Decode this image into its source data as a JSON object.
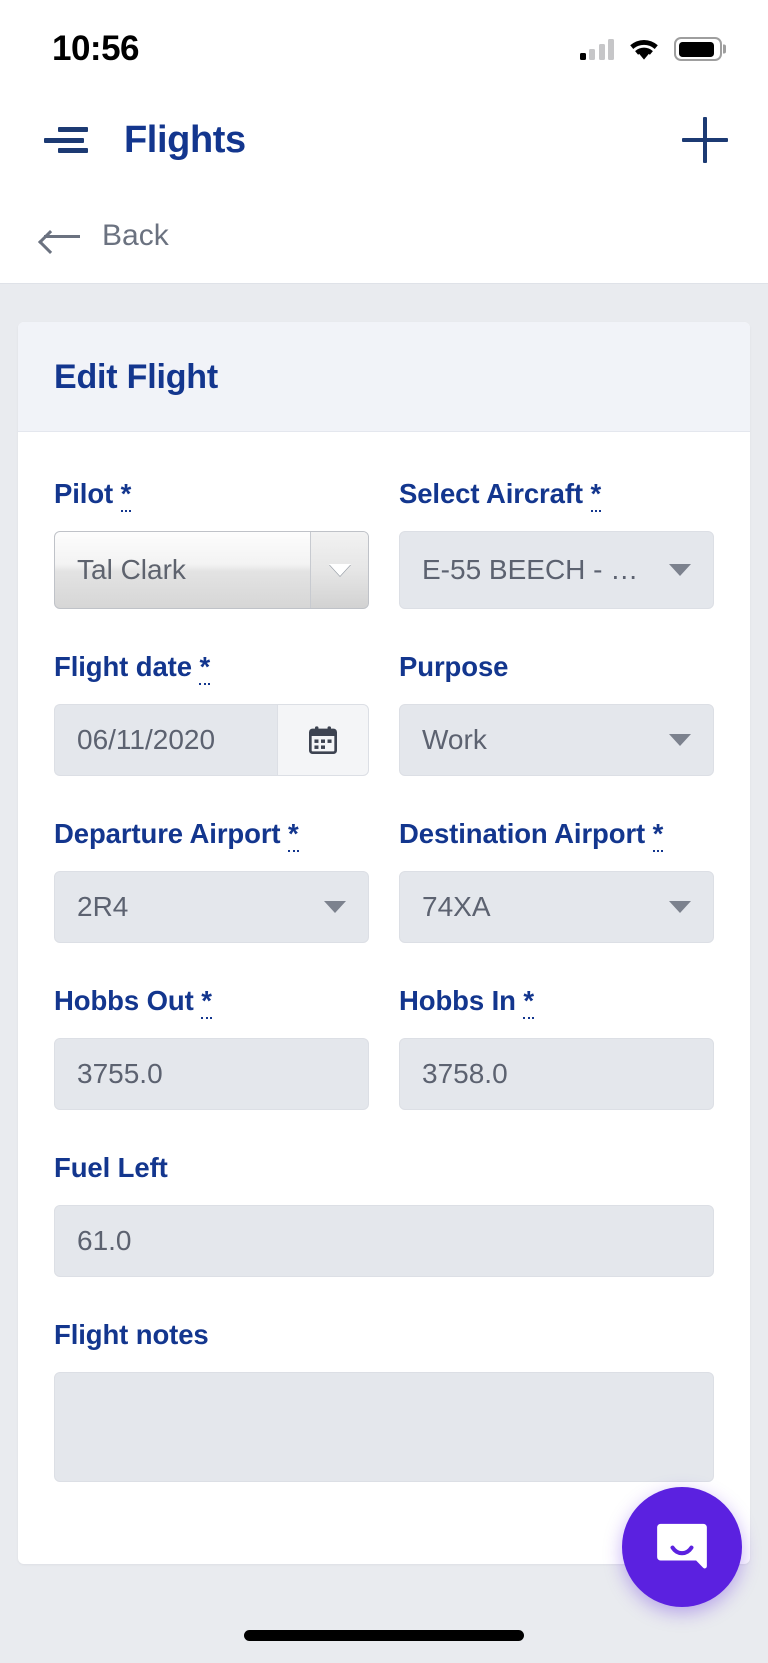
{
  "status_bar": {
    "time": "10:56",
    "cellular_icon": "cellular-signal-icon",
    "wifi_icon": "wifi-icon",
    "battery_icon": "battery-full-icon"
  },
  "app_bar": {
    "menu_icon": "hamburger-menu-icon",
    "title": "Flights",
    "add_icon": "plus-icon",
    "title_color": "#13368e"
  },
  "back_bar": {
    "arrow_icon": "arrow-left-icon",
    "label": "Back"
  },
  "card": {
    "title": "Edit Flight"
  },
  "form": {
    "pilot": {
      "label": "Pilot",
      "required_mark": "*",
      "value": "Tal Clark",
      "control": "select"
    },
    "aircraft": {
      "label": "Select Aircraft",
      "required_mark": "*",
      "value": "E-55 BEECH - N3...",
      "control": "select"
    },
    "flight_date": {
      "label": "Flight date",
      "required_mark": "*",
      "value": "06/11/2020",
      "calendar_icon": "calendar-icon",
      "control": "date"
    },
    "purpose": {
      "label": "Purpose",
      "required_mark": "",
      "value": "Work",
      "control": "select"
    },
    "departure_airport": {
      "label": "Departure Airport",
      "required_mark": "*",
      "value": "2R4",
      "control": "select"
    },
    "destination_airport": {
      "label": "Destination Airport",
      "required_mark": "*",
      "value": "74XA",
      "control": "select"
    },
    "hobbs_out": {
      "label": "Hobbs Out",
      "required_mark": "*",
      "value": "3755.0",
      "control": "text"
    },
    "hobbs_in": {
      "label": "Hobbs In",
      "required_mark": "*",
      "value": "3758.0",
      "control": "text"
    },
    "fuel_left": {
      "label": "Fuel Left",
      "required_mark": "",
      "value": "61.0",
      "control": "text"
    },
    "flight_notes": {
      "label": "Flight notes",
      "required_mark": "",
      "value": "",
      "control": "textarea"
    }
  },
  "chat_fab": {
    "icon": "intercom-chat-icon",
    "color": "#5b21e0"
  }
}
